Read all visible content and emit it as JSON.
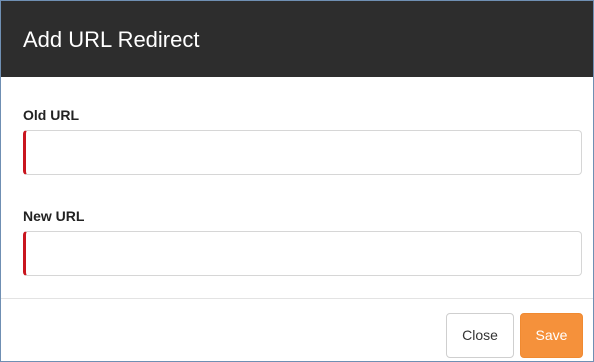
{
  "modal": {
    "title": "Add URL Redirect"
  },
  "form": {
    "old_url": {
      "label": "Old URL",
      "value": "",
      "placeholder": ""
    },
    "new_url": {
      "label": "New URL",
      "value": "",
      "placeholder": ""
    }
  },
  "footer": {
    "close_label": "Close",
    "save_label": "Save"
  },
  "colors": {
    "header_bg": "#2d2d2d",
    "required_indicator": "#c9161f",
    "save_button": "#f5913b",
    "modal_border": "#6f8fb3"
  }
}
